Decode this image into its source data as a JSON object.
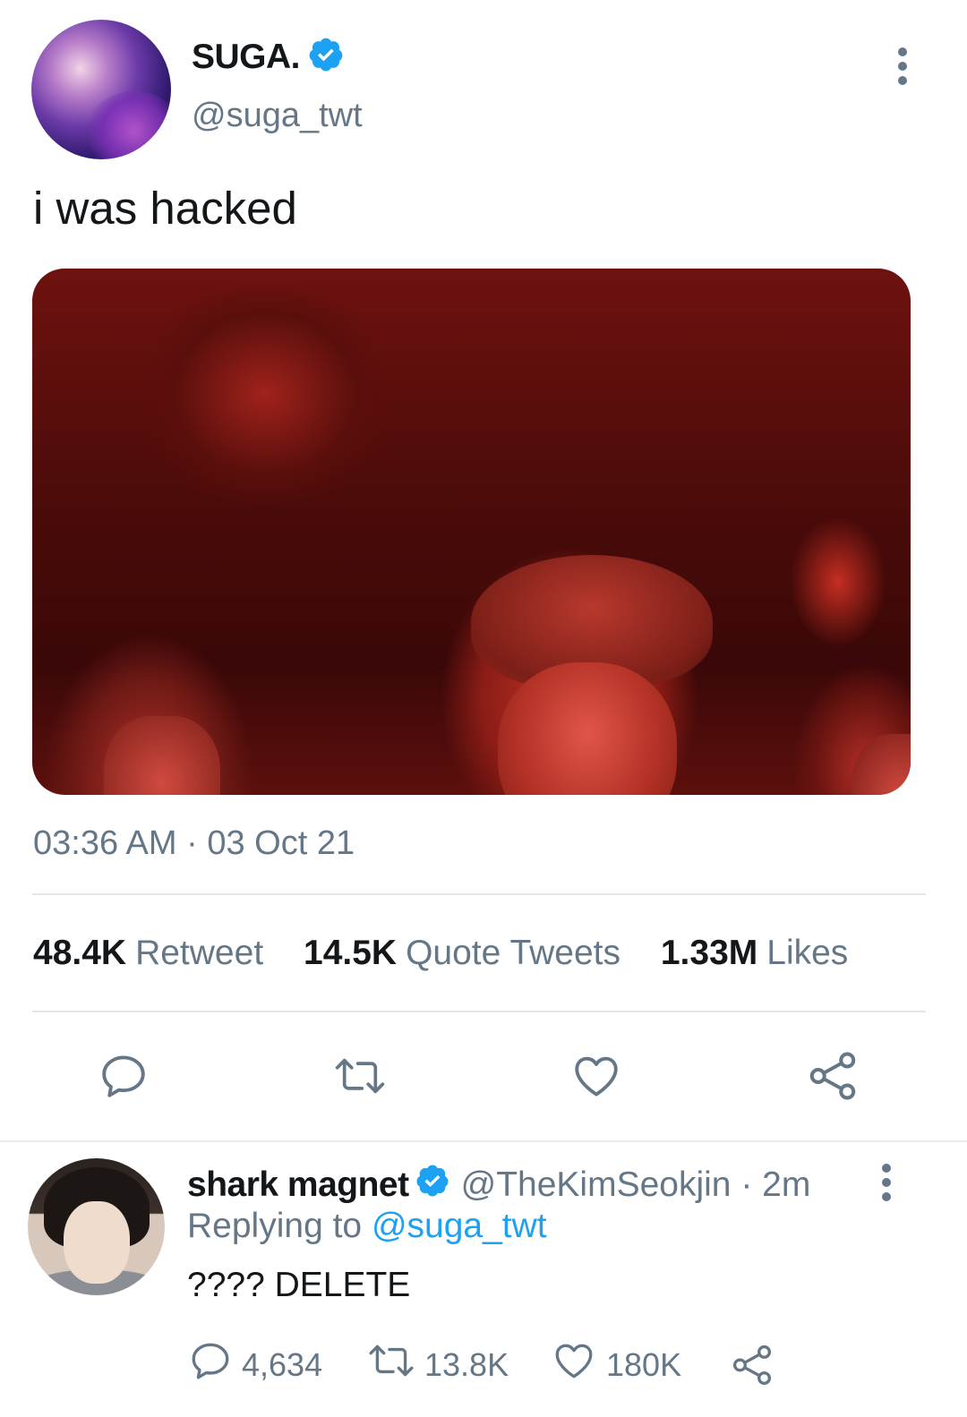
{
  "main_tweet": {
    "display_name": "SUGA.",
    "handle": "@suga_twt",
    "text": "i was hacked",
    "timestamp": "03:36 AM · 03 Oct 21",
    "stats": [
      {
        "count": "48.4K",
        "label": "Retweet"
      },
      {
        "count": "14.5K",
        "label": "Quote Tweets"
      },
      {
        "count": "1.33M",
        "label": "Likes"
      }
    ],
    "icons": {
      "reply": "reply-icon",
      "retweet": "retweet-icon",
      "like": "heart-icon",
      "share": "share-icon",
      "more": "more-vertical-icon",
      "verified": "verified-badge-icon"
    }
  },
  "reply": {
    "display_name": "shark magnet",
    "handle_meta": "@TheKimSeokjin · 2m",
    "replying_prefix": "Replying to ",
    "replying_to": "@suga_twt",
    "text": "???? DELETE",
    "counts": {
      "replies": "4,634",
      "retweets": "13.8K",
      "likes": "180K"
    }
  },
  "colors": {
    "text_primary": "#14171a",
    "text_secondary": "#657786",
    "accent_blue": "#1da1f2",
    "divider": "#e1e8ed"
  }
}
